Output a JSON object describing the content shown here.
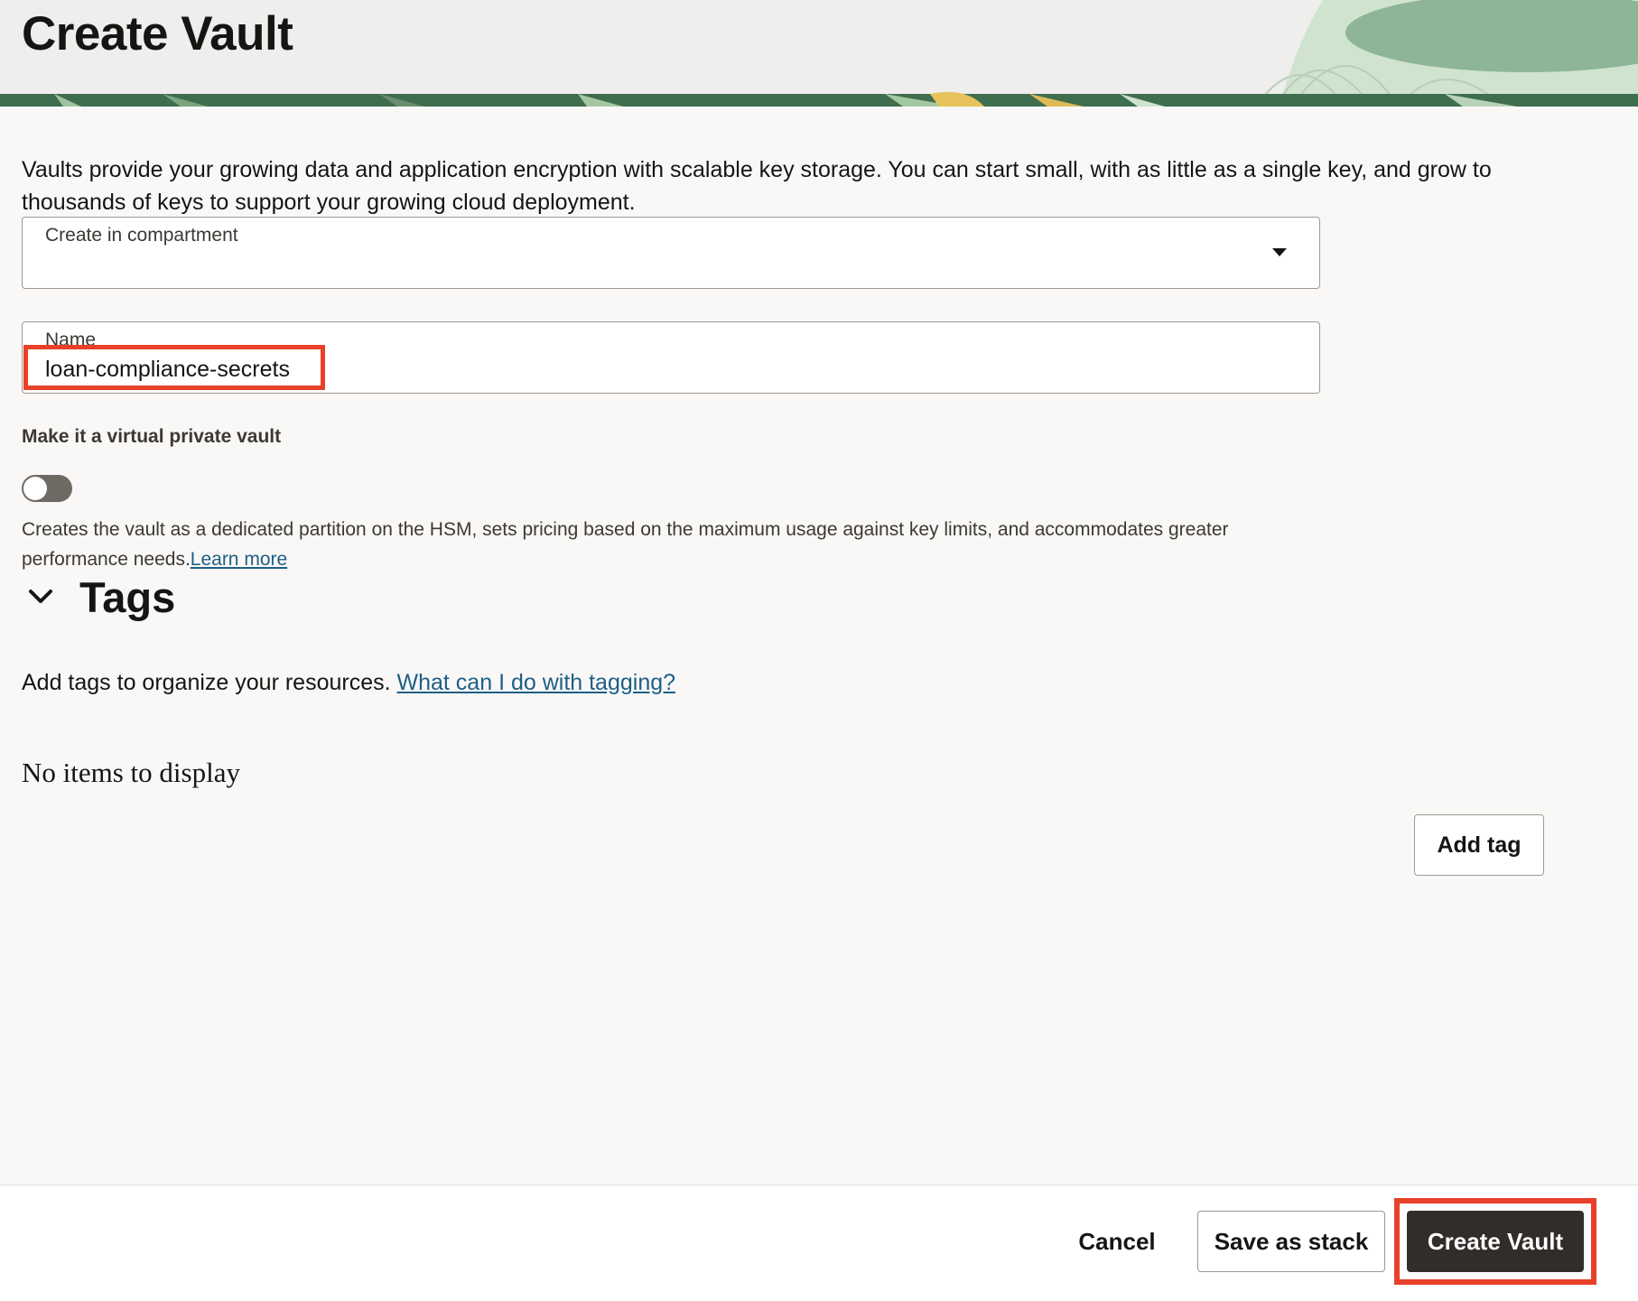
{
  "header": {
    "title": "Create Vault"
  },
  "intro": {
    "text": "Vaults provide your growing data and application encryption with scalable key storage. You can start small, with as little as a single key, and grow to thousands of keys to support your growing cloud deployment."
  },
  "compartment": {
    "label": "Create in compartment",
    "value": "",
    "icon": "chevron-down-icon"
  },
  "name_field": {
    "label": "Name",
    "value": "loan-compliance-secrets"
  },
  "virtual_private": {
    "label": "Make it a virtual private vault",
    "enabled": false,
    "help_text": "Creates the vault as a dedicated partition on the HSM, sets pricing based on the maximum usage against key limits, and accommodates greater performance needs.",
    "learn_more": "Learn more"
  },
  "tags": {
    "title": "Tags",
    "help_text": "Add tags to organize your resources.",
    "help_link": "What can I do with tagging?",
    "empty_message": "No items to display",
    "add_button": "Add tag"
  },
  "footer": {
    "cancel": "Cancel",
    "save_stack": "Save as stack",
    "create": "Create Vault"
  },
  "colors": {
    "highlight": "#e8402a",
    "primary_button": "#312d2a",
    "link": "#1d5f86"
  }
}
